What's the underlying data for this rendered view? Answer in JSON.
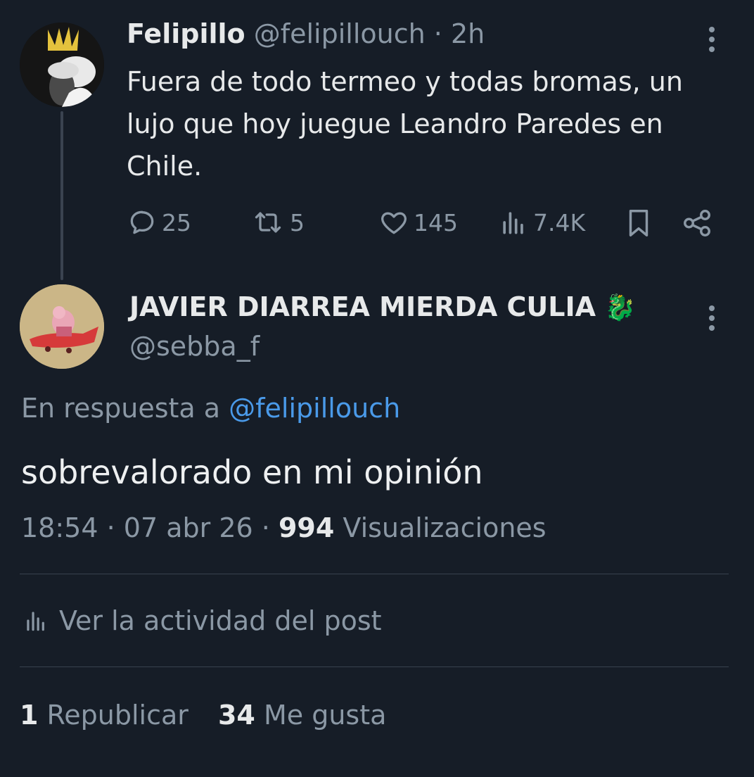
{
  "parent_tweet": {
    "display_name": "Felipillo",
    "handle": "@felipillouch",
    "separator": "·",
    "time_ago": "2h",
    "text_lines": [
      "Fuera de todo termeo y todas bromas, un",
      "lujo que hoy juegue Leandro Paredes en",
      "Chile."
    ],
    "replies": "25",
    "reposts": "5",
    "likes": "145",
    "views": "7.4K"
  },
  "reply_tweet": {
    "display_name": "JAVIER DIARREA MIERDA CULIA",
    "name_emoji": "🐉",
    "handle": "@sebba_f",
    "in_reply_prefix": "En respuesta a",
    "in_reply_handle": "@felipillouch",
    "text": "sobrevalorado en mi opinión",
    "time": "18:54",
    "date": "07 abr 26",
    "sep": "·",
    "views_count": "994",
    "views_label": "Visualizaciones",
    "activity_label": "Ver la actividad del post",
    "repost_count": "1",
    "repost_label": "Republicar",
    "like_count": "34",
    "like_label": "Me gusta"
  },
  "colors": {
    "background": "#161d27",
    "text": "#e7e9ea",
    "muted": "#8b98a5",
    "link": "#4a9ae9"
  }
}
